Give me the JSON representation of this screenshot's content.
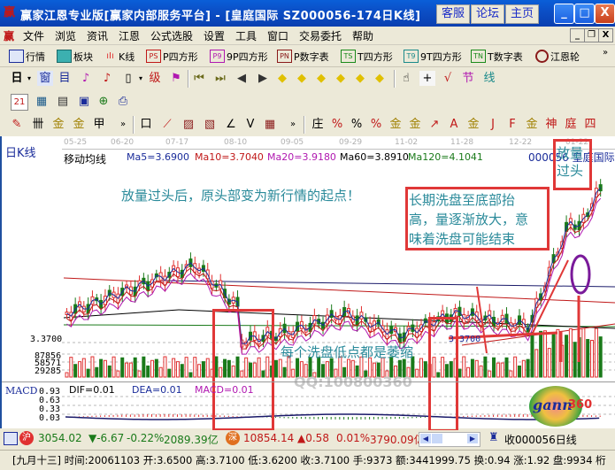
{
  "window": {
    "title": "赢家江恩专业版[赢家内部服务平台] - [皇庭国际 SZ000056-174日K线]",
    "app_icon": "赢",
    "buttons": [
      "客服",
      "论坛",
      "主页"
    ],
    "controls": {
      "minimize": "_",
      "maximize": "□",
      "close": "X"
    }
  },
  "menu": {
    "icon": "赢",
    "items": [
      "文件",
      "浏览",
      "资讯",
      "江恩",
      "公式选股",
      "设置",
      "工具",
      "窗口",
      "交易委托",
      "帮助"
    ],
    "mdi_controls": [
      "_",
      "❐",
      "X"
    ]
  },
  "toolbar1": {
    "items": [
      {
        "icon": "grid-table-icon",
        "label": "行情"
      },
      {
        "icon": "blocks-icon",
        "label": "板块"
      },
      {
        "icon": "candlestick-icon",
        "label": "K线"
      },
      {
        "icon": "PS",
        "label": "P四方形"
      },
      {
        "icon": "P9",
        "label": "9P四方形"
      },
      {
        "icon": "PN",
        "label": "P数字表"
      },
      {
        "icon": "TS",
        "label": "T四方形"
      },
      {
        "icon": "T9",
        "label": "9T四方形"
      },
      {
        "icon": "TN",
        "label": "T数字表"
      },
      {
        "icon": "gann-wheel-icon",
        "label": "江恩轮"
      }
    ],
    "overflow": "»"
  },
  "toolbar2": {
    "period": "日",
    "glyphs": [
      "窗",
      "目",
      "♪",
      "♪",
      "▯",
      "级",
      "⚑",
      "⏮",
      "⏭",
      "◀",
      "▶",
      "◆",
      "◆",
      "◆",
      "◆",
      "◆",
      "◆",
      "☝",
      "+",
      "√",
      "节",
      "线"
    ]
  },
  "toolbar3": {
    "glyphs": [
      "21",
      "▦",
      "▤",
      "▣",
      "⊕",
      "⎙"
    ]
  },
  "toolbar4": {
    "left_glyphs": [
      "✎",
      "卌",
      "金",
      "金",
      "甲",
      "»"
    ],
    "mid_glyphs": [
      "口",
      "⟋",
      "▨",
      "▧",
      "∠",
      "V",
      "▦",
      "»"
    ],
    "right_glyphs": [
      "庄",
      "%",
      "%",
      "%",
      "金",
      "金",
      "↗",
      "A",
      "金",
      "J",
      "F",
      "金",
      "神",
      "庭",
      "四"
    ]
  },
  "chart": {
    "period_label": "日K线",
    "indicator_name": "移动均线",
    "date_ticks": [
      "05-25",
      "06-20",
      "07-17",
      "08-10",
      "09-05",
      "09-29",
      "11-02",
      "11-28",
      "12-22",
      "01-22"
    ],
    "ma": [
      {
        "label": "Ma5=3.6900",
        "color": "#1a2c9a"
      },
      {
        "label": "Ma10=3.7040",
        "color": "#c01818"
      },
      {
        "label": "Ma20=3.9180",
        "color": "#b018b0"
      },
      {
        "label": "Ma60=3.8910",
        "color": "#000000"
      },
      {
        "label": "Ma120=4.1041",
        "color": "#1a7a1a"
      }
    ],
    "stock": "000056 皇庭国际",
    "price_label": "3.3700",
    "low_marker": "3.3700",
    "volume_ticks": [
      "87856",
      "58571",
      "29285"
    ],
    "annotations": {
      "headline": "放量过头后，原头部变为新行情的起点！",
      "top_box": [
        "放量",
        "过头"
      ],
      "middle_box": [
        "长期洗盘至底部抬",
        "高，量逐渐放大，意",
        "味着洗盘可能结束"
      ],
      "bottom": "每个洗盘低点都是萎缩"
    },
    "watermark_qq": "QQ:100800360"
  },
  "macd": {
    "name": "MACD",
    "dif": "DIF=0.01",
    "dea": "DEA=0.01",
    "macd": "MACD=0.01",
    "ticks": [
      "0.93",
      "0.63",
      "0.33",
      "0.03"
    ]
  },
  "logo": {
    "text": "gann",
    "num": "360"
  },
  "status1": {
    "sh_badge": "沪",
    "sh_index": "3054.02",
    "sh_change": "▼-6.67",
    "sh_pct": "-0.22%",
    "sh_amount": "2089.39亿",
    "sz_badge": "深",
    "sz_index": "10854.14",
    "sz_change": "▲0.58",
    "sz_pct": "0.01%",
    "sz_amount": "3790.09亿",
    "right_label": "收000056日线"
  },
  "status2": {
    "text": "[九月十三] 时间:20061103 开:3.6500 高:3.7100 低:3.6200 收:3.7100 手:9373 额:3441999.75 换:0.94 涨:1.92 盘:9934 桁"
  },
  "colors": {
    "up": "#e03030",
    "down": "#1a7a1a",
    "annotation": "#2a8a9a",
    "box": "#e03838",
    "circle": "#7a1a9a"
  }
}
